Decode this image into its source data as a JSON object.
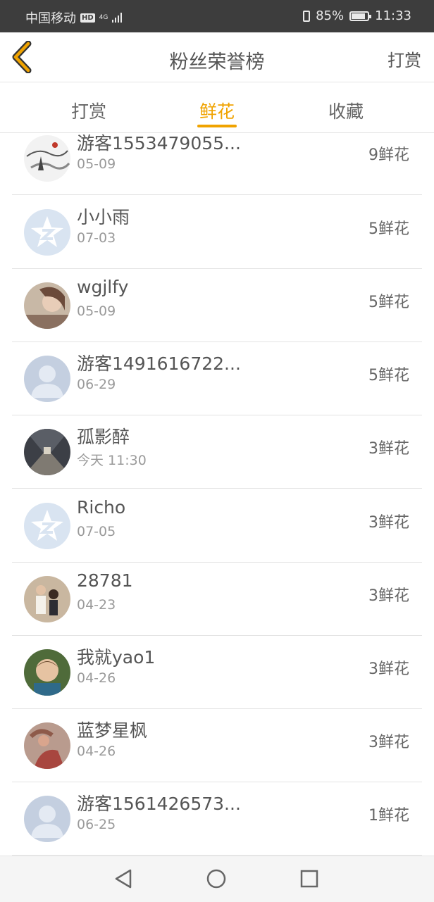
{
  "status_bar": {
    "carrier": "中国移动",
    "hd": "HD",
    "network": "4G",
    "battery": "85%",
    "battery_level": 0.85,
    "time": "11:33"
  },
  "header": {
    "title": "粉丝荣誉榜",
    "action_label": "打赏",
    "back_icon": "chevron-left-icon",
    "accent_color": "#f0a300"
  },
  "tabs": [
    {
      "label": "打赏",
      "active": false
    },
    {
      "label": "鲜花",
      "active": true
    },
    {
      "label": "收藏",
      "active": false
    }
  ],
  "fans": [
    {
      "name": "游客1553479055...",
      "date": "05-09",
      "count": "9鲜花",
      "avatar": "ink-painting-avatar"
    },
    {
      "name": "小小雨",
      "date": "07-03",
      "count": "5鲜花",
      "avatar": "qzone-default-avatar"
    },
    {
      "name": "wgjlfy",
      "date": "05-09",
      "count": "5鲜花",
      "avatar": "photo-avatar"
    },
    {
      "name": "游客1491616722...",
      "date": "06-29",
      "count": "5鲜花",
      "avatar": "default-user-avatar"
    },
    {
      "name": "孤影醉",
      "date": "今天 11:30",
      "count": "3鲜花",
      "avatar": "tunnel-photo-avatar"
    },
    {
      "name": "Richo",
      "date": "07-05",
      "count": "3鲜花",
      "avatar": "qzone-default-avatar"
    },
    {
      "name": "28781",
      "date": "04-23",
      "count": "3鲜花",
      "avatar": "couple-photo-avatar"
    },
    {
      "name": "我就yao1",
      "date": "04-26",
      "count": "3鲜花",
      "avatar": "child-photo-avatar"
    },
    {
      "name": "蓝梦星枫",
      "date": "04-26",
      "count": "3鲜花",
      "avatar": "photo-avatar"
    },
    {
      "name": "游客1561426573...",
      "date": "06-25",
      "count": "1鲜花",
      "avatar": "default-user-avatar"
    }
  ],
  "nav_bar": {
    "back_icon": "triangle-back-icon",
    "home_icon": "circle-home-icon",
    "recents_icon": "square-recents-icon"
  }
}
